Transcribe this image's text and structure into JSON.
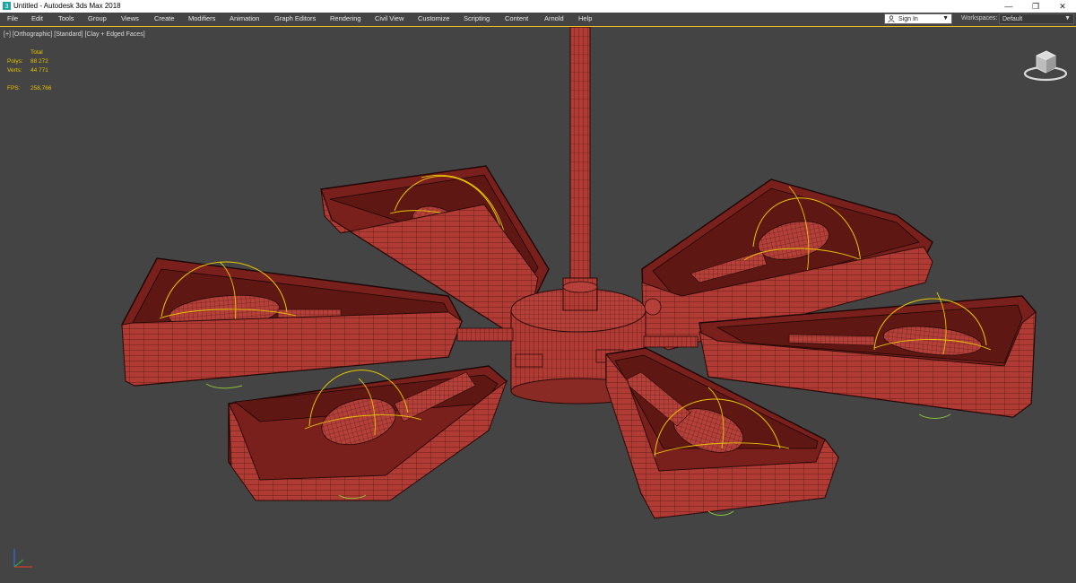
{
  "window": {
    "title": "Untitled - Autodesk 3ds Max 2018",
    "controls": {
      "minimize": "—",
      "restore": "❐",
      "close": "✕"
    }
  },
  "menu": [
    "File",
    "Edit",
    "Tools",
    "Group",
    "Views",
    "Create",
    "Modifiers",
    "Animation",
    "Graph Editors",
    "Rendering",
    "Civil View",
    "Customize",
    "Scripting",
    "Content",
    "Arnold",
    "Help"
  ],
  "account": {
    "label": "Sign In",
    "icon": "user-icon",
    "arrow": "▼"
  },
  "workspaces": {
    "label": "Workspaces:",
    "value": "Default",
    "arrow": "▼"
  },
  "viewport": {
    "label": {
      "plus": "[+]",
      "view": "[Orthographic]",
      "shading_mode": "[Standard]",
      "style": "[Clay + Edged Faces]"
    },
    "stats": {
      "header": "Total",
      "polys_label": "Polys:",
      "polys": "88 272",
      "verts_label": "Verts:",
      "verts": "44 771",
      "fps_label": "FPS:",
      "fps": "258,766"
    }
  },
  "colors": {
    "clay": "#b03a34",
    "clay_dark": "#7a201c",
    "wire": "#2a0a08",
    "light_gizmo": "#e8c600",
    "viewport_bg": "#444444",
    "active_border": "#f0c020",
    "stats_text": "#e6c200"
  },
  "icons": [
    "app-icon",
    "user-icon",
    "viewcube-icon",
    "axis-tripod-icon"
  ]
}
